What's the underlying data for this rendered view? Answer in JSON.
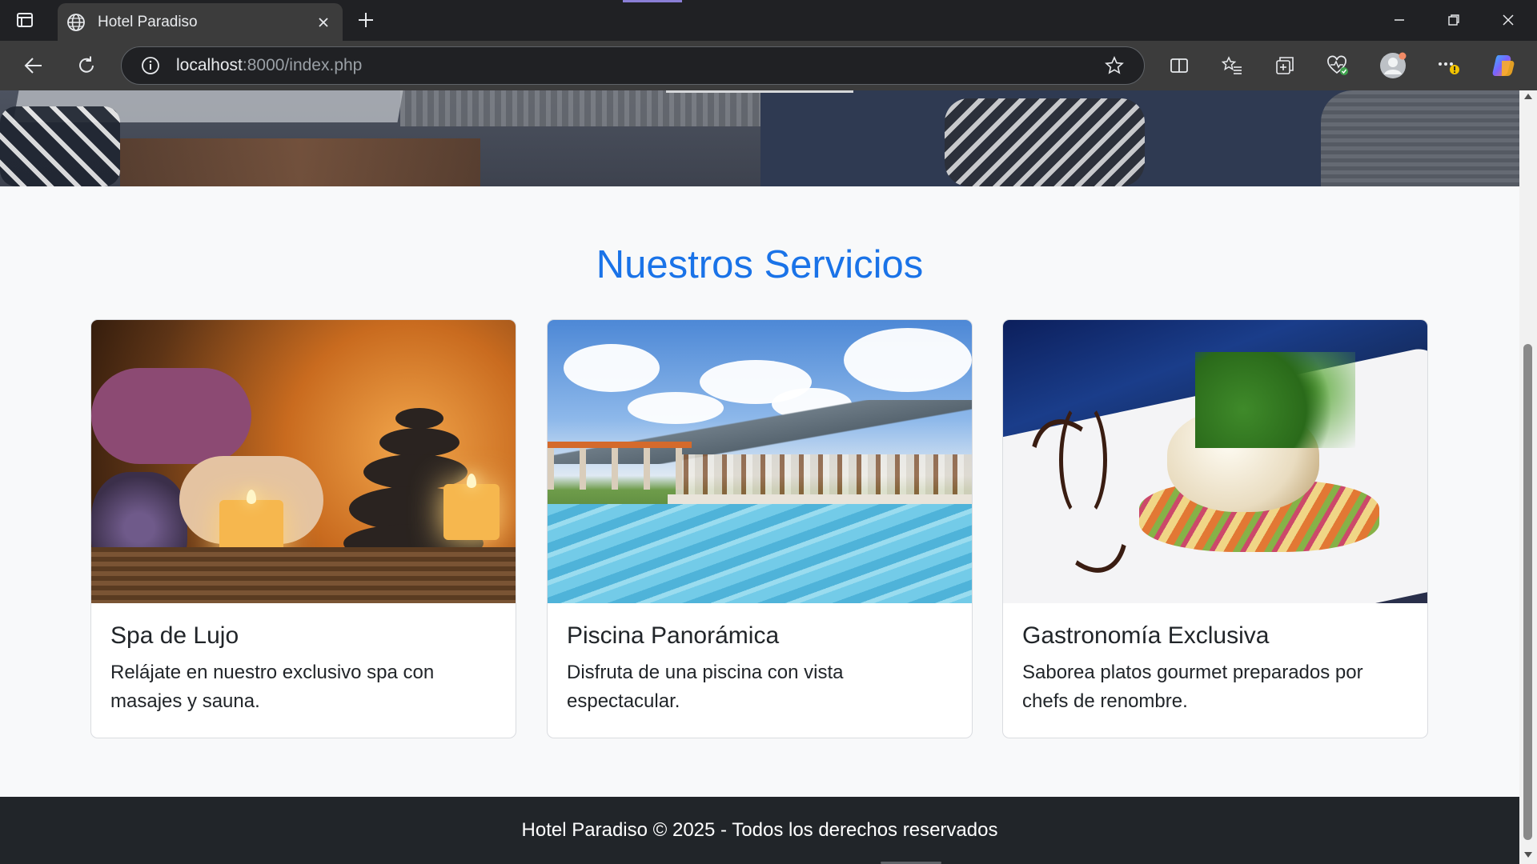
{
  "browser": {
    "tab_title": "Hotel Paradiso",
    "url_host": "localhost",
    "url_rest": ":8000/index.php"
  },
  "page": {
    "section_title": "Nuestros Servicios",
    "cards": [
      {
        "title": "Spa de Lujo",
        "text": "Relájate en nuestro exclusivo spa con masajes y sauna."
      },
      {
        "title": "Piscina Panorámica",
        "text": "Disfruta de una piscina con vista espectacular."
      },
      {
        "title": "Gastronomía Exclusiva",
        "text": "Saborea platos gourmet preparados por chefs de renombre."
      }
    ],
    "footer": "Hotel Paradiso © 2025 - Todos los derechos reservados"
  },
  "colors": {
    "accent": "#1a73e8",
    "footer_bg": "#212529",
    "page_bg": "#f8f9fa"
  }
}
